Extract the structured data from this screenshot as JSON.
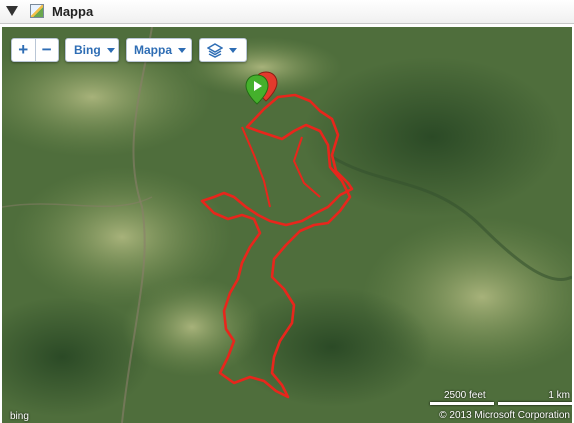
{
  "panel": {
    "title": "Mappa",
    "collapse_icon": "triangle-down-icon",
    "map_app_icon": "map-icon"
  },
  "map": {
    "basemap": "aerial",
    "zoom_in_label": "+",
    "zoom_out_label": "−",
    "provider_button": "Bing",
    "map_type_button": "Mappa",
    "layers_icon": "layers-icon",
    "route_color": "#e8261c",
    "start_marker_color": "#45b02c",
    "end_marker_color": "#e23a2c",
    "scale": {
      "feet_label": "2500 feet",
      "km_label": "1 km"
    },
    "copyright": "© 2013 Microsoft Corporation",
    "logo": "bing"
  }
}
